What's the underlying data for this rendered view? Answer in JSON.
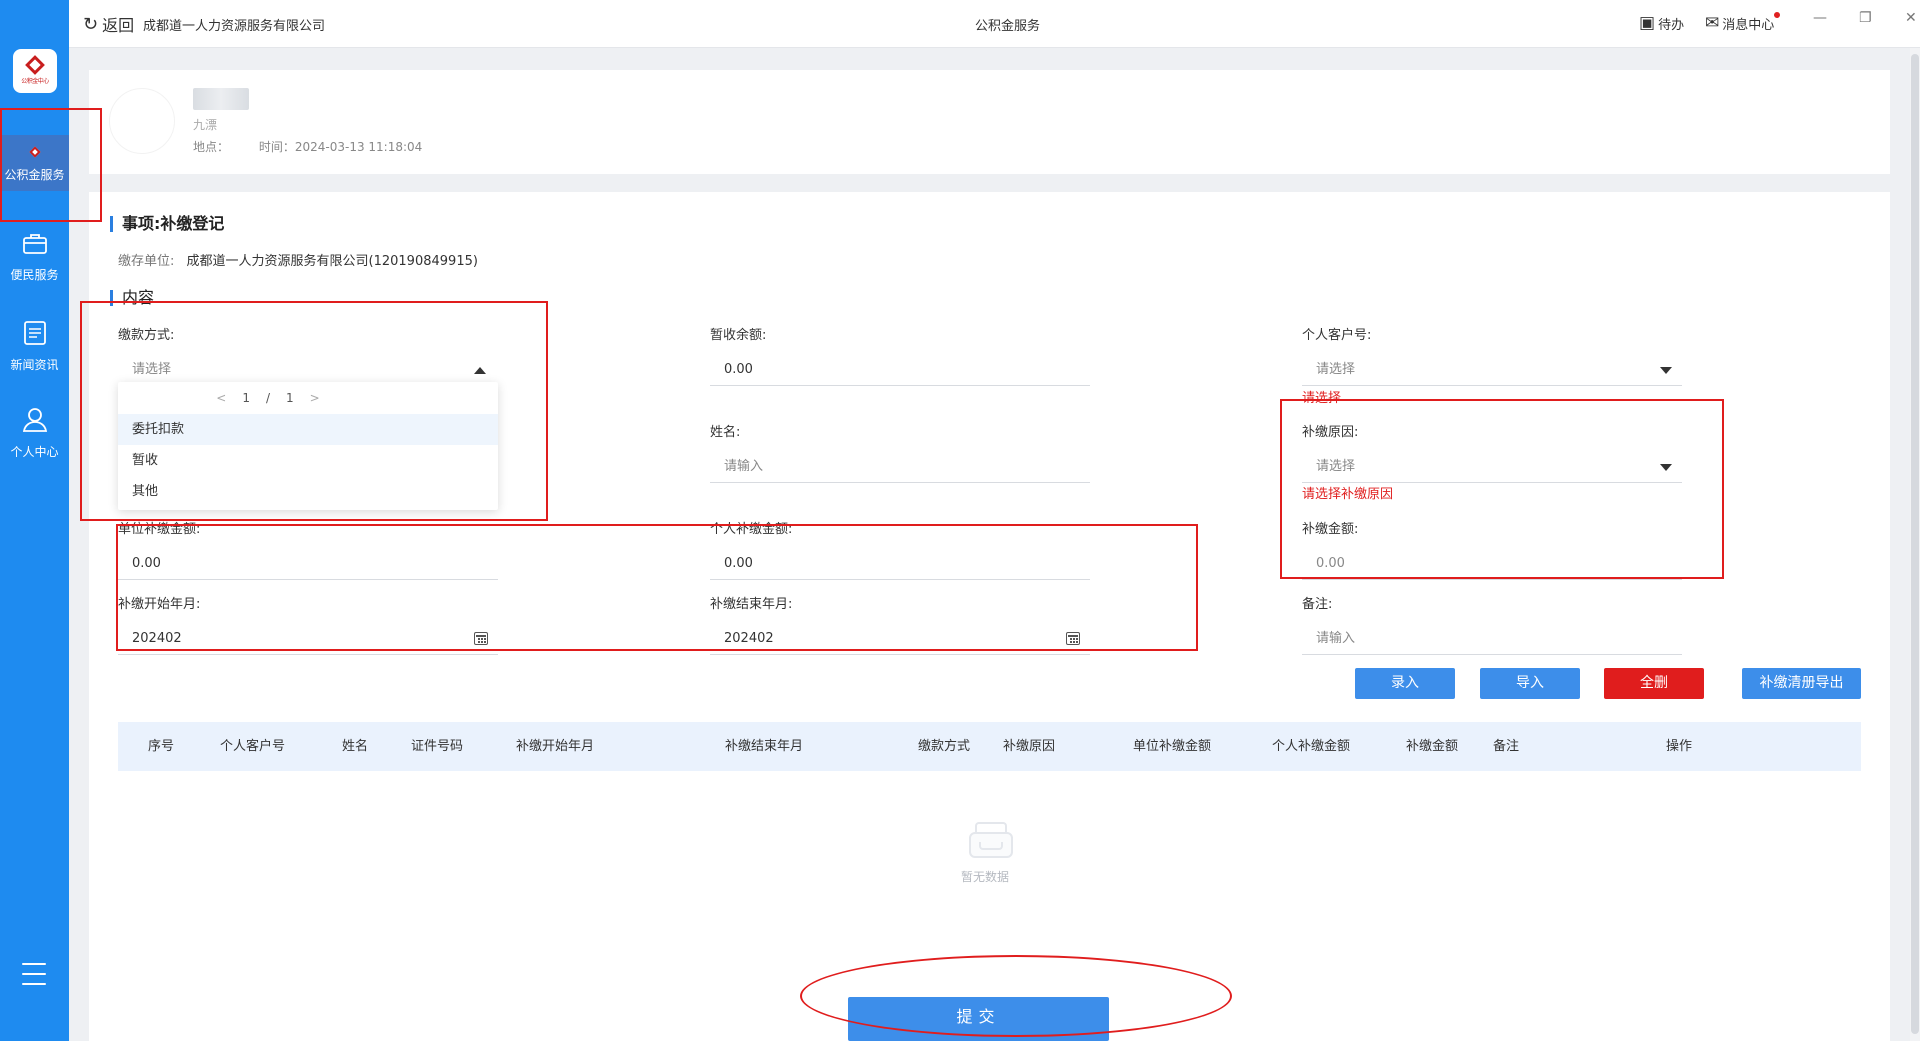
{
  "topbar": {
    "back_label": "返回",
    "company": "成都道一人力资源服务有限公司",
    "title": "公积金服务",
    "todo_label": "待办",
    "message_label": "消息中心"
  },
  "sidebar": {
    "logo_text": "公积金中心",
    "items": [
      {
        "label": "公积金服务",
        "icon": "fund-logo-icon",
        "active": true
      },
      {
        "label": "便民服务",
        "icon": "briefcase-icon"
      },
      {
        "label": "新闻资讯",
        "icon": "news-icon"
      },
      {
        "label": "个人中心",
        "icon": "user-icon"
      }
    ],
    "menu_icon": "hamburger-icon"
  },
  "info": {
    "sub_text": "九漂",
    "location_label": "地点：",
    "time_label": "时间：2024-03-13 11:18:04"
  },
  "form": {
    "matter_title": "事项:补缴登记",
    "unit_label": "缴存单位:",
    "unit_value": "成都道一人力资源服务有限公司(120190849915)",
    "content_title": "内容",
    "payment_method": {
      "label": "缴款方式:",
      "placeholder": "请选择"
    },
    "dropdown": {
      "page": "1",
      "sep": "/",
      "total": "1",
      "options": [
        "委托扣款",
        "暂收",
        "其他"
      ]
    },
    "temp_balance": {
      "label": "暂收余额:",
      "value": "0.00"
    },
    "personal_account": {
      "label": "个人客户号:",
      "placeholder": "请选择",
      "error": "请选择"
    },
    "name": {
      "label": "姓名:",
      "placeholder": "请输入"
    },
    "reason": {
      "label": "补缴原因:",
      "placeholder": "请选择",
      "error": "请选择补缴原因"
    },
    "unit_amount": {
      "label": "单位补缴金额:",
      "value": "0.00"
    },
    "personal_amount": {
      "label": "个人补缴金额:",
      "value": "0.00"
    },
    "total_amount": {
      "label": "补缴金额:",
      "value": "0.00"
    },
    "start_month": {
      "label": "补缴开始年月:",
      "value": "202402"
    },
    "end_month": {
      "label": "补缴结束年月:",
      "value": "202402"
    },
    "remark": {
      "label": "备注:",
      "placeholder": "请输入"
    }
  },
  "buttons": {
    "enter": "录入",
    "import": "导入",
    "delete_all": "全删",
    "export": "补缴清册导出",
    "submit": "提交"
  },
  "table": {
    "headers": [
      "序号",
      "个人客户号",
      "姓名",
      "证件号码",
      "补缴开始年月",
      "补缴结束年月",
      "缴款方式",
      "补缴原因",
      "单位补缴金额",
      "个人补缴金额",
      "补缴金额",
      "备注",
      "操作"
    ],
    "empty_text": "暂无数据"
  },
  "colors": {
    "sidebar": "#1e8bf0",
    "primary_button": "#3d8eea",
    "danger_button": "#e01d1d",
    "error_text": "#e02020",
    "annotation": "#e01d1d"
  }
}
